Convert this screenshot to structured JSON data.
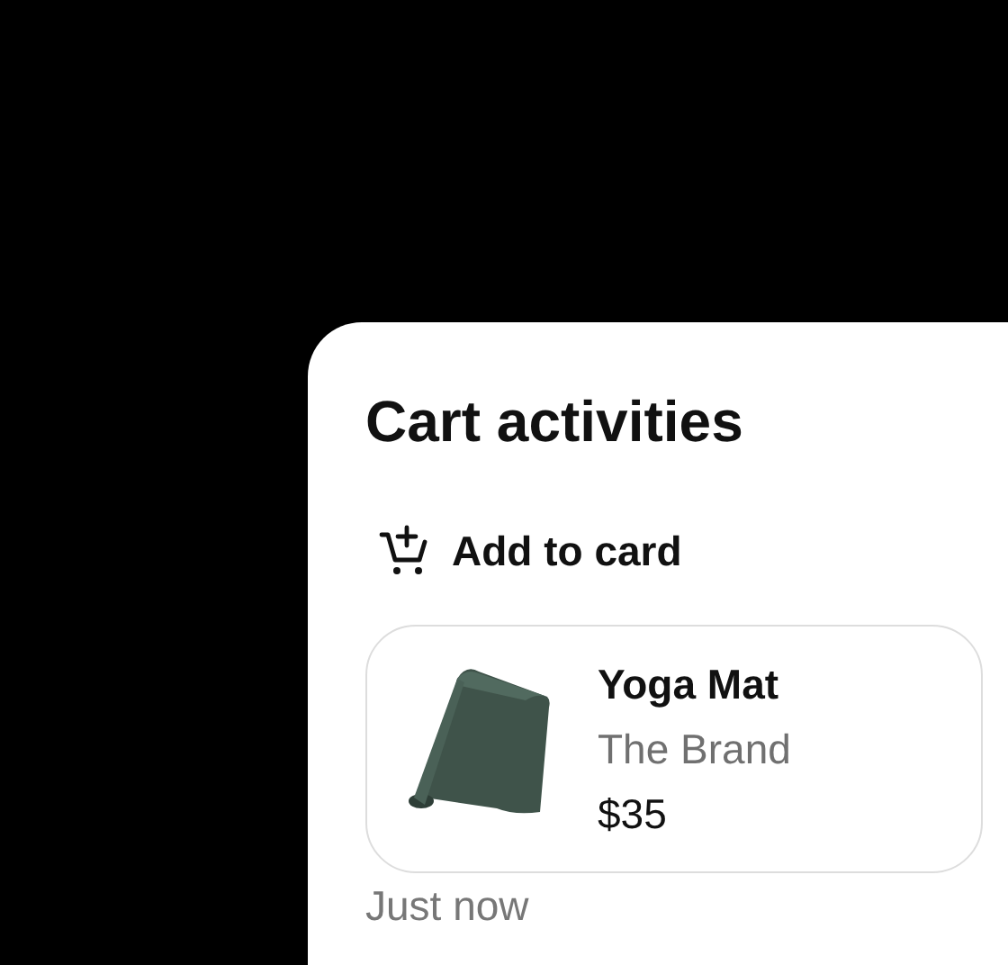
{
  "panel": {
    "title": "Cart activities",
    "activity": {
      "label": "Add to card",
      "product": {
        "name": "Yoga Mat",
        "brand": "The Brand",
        "price": "$35"
      },
      "time": "Just now"
    }
  }
}
